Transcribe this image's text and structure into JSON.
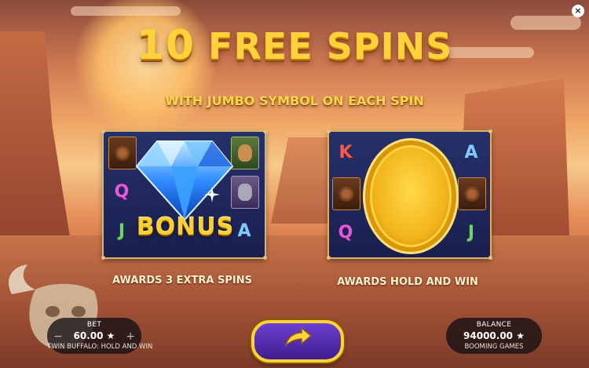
{
  "title": {
    "number": "10",
    "text": "FREE SPINS"
  },
  "subtitle": "WITH JUMBO SYMBOL ON EACH SPIN",
  "left_panel": {
    "symbols": {
      "q": "Q",
      "j": "J",
      "a": "A"
    },
    "bonus_label": "BONUS",
    "award": "AWARDS 3 EXTRA SPINS"
  },
  "right_panel": {
    "symbols": {
      "k": "K",
      "a": "A",
      "q": "Q",
      "j": "J"
    },
    "award": "AWARDS HOLD AND WIN"
  },
  "bet": {
    "label": "BET",
    "value": "60.00 ★",
    "minus": "−",
    "plus": "+",
    "game_name": "TWIN BUFFALO: HOLD AND WIN"
  },
  "balance": {
    "label": "BALANCE",
    "value": "94000.00 ★",
    "provider": "BOOMING GAMES"
  },
  "close_label": "×",
  "colors": {
    "title_gold": "#ffd23a",
    "panel_bg": "#1a1f4f",
    "play_purple": "#5a2fb8"
  },
  "icons": {
    "close": "close-icon",
    "play": "arrow-right-icon"
  }
}
